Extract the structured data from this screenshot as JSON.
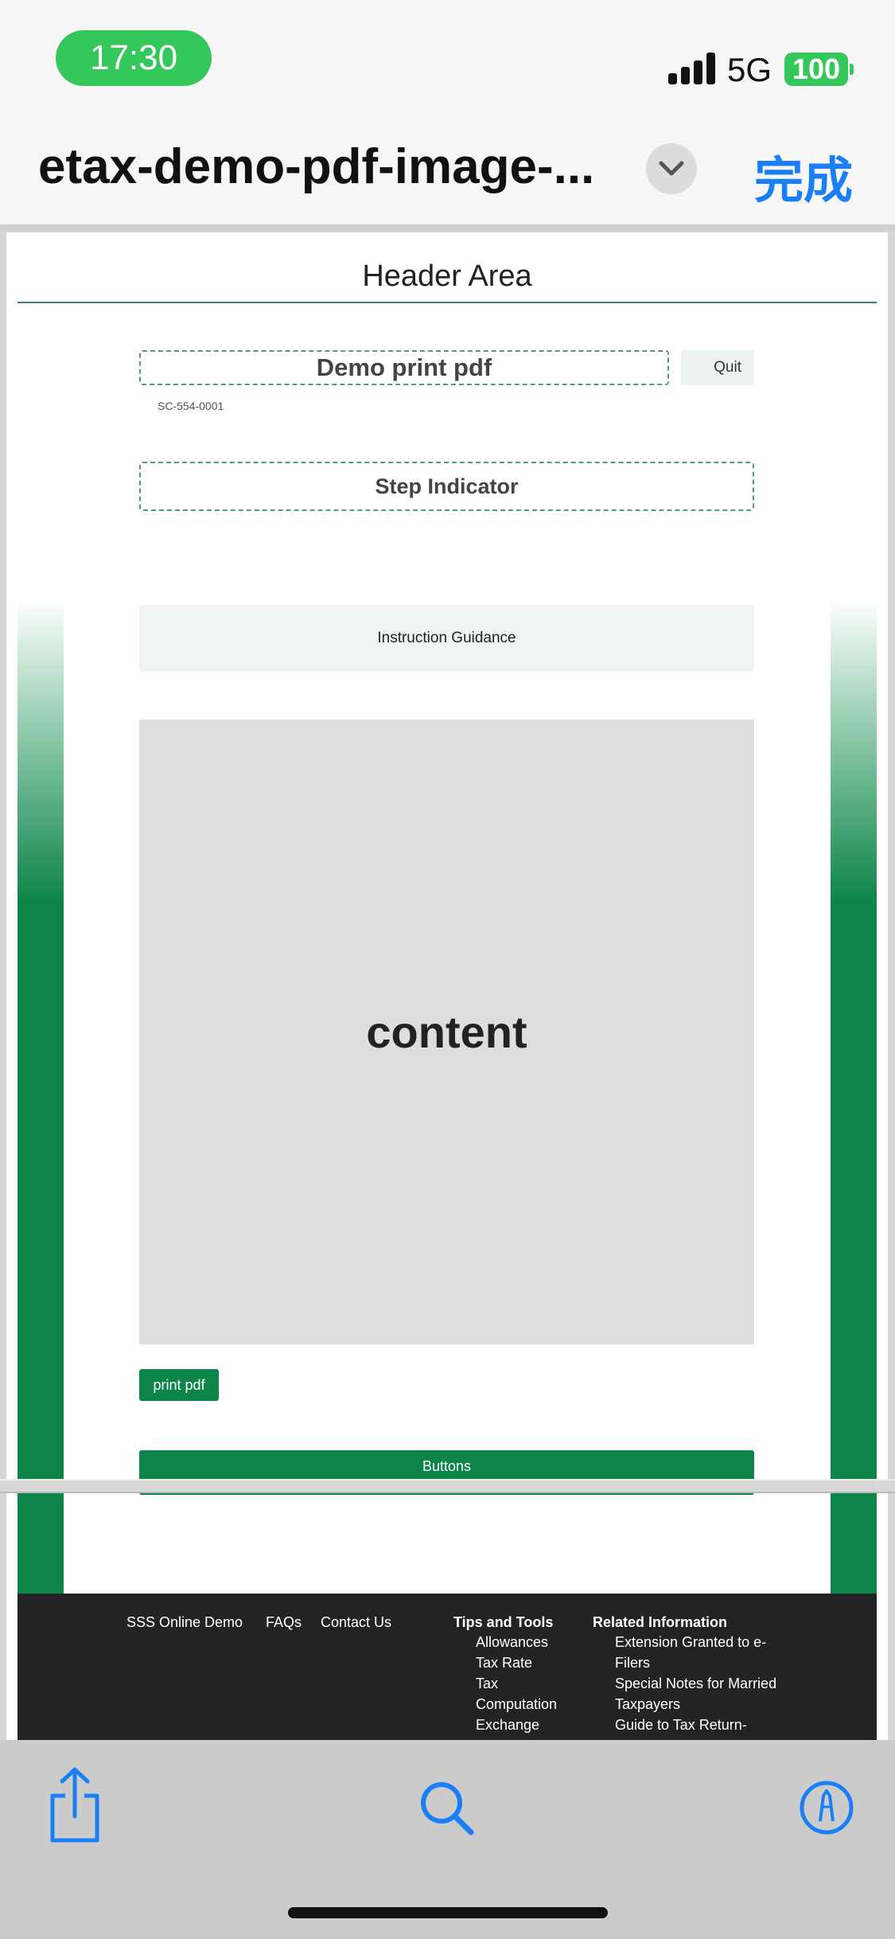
{
  "status_bar": {
    "time": "17:30",
    "network": "5G",
    "battery": "100"
  },
  "nav": {
    "document_title": "etax-demo-pdf-image-...",
    "done_label": "完成"
  },
  "page": {
    "header_area": "Header Area",
    "title": "Demo print pdf",
    "quit_label": "Quit",
    "screen_id": "SC-554-0001",
    "step_indicator": "Step Indicator",
    "instruction_guidance": "Instruction Guidance",
    "content_label": "content",
    "print_button": "print pdf",
    "buttons_bar": "Buttons"
  },
  "footer": {
    "links": [
      "SSS Online Demo",
      "FAQs",
      "Contact Us"
    ],
    "tips_heading": "Tips and Tools",
    "tips_items": [
      "Allowances",
      "Tax Rate",
      "Tax",
      "Computation",
      "Exchange"
    ],
    "related_heading": "Related Information",
    "related_items": [
      "Extension Granted to e-",
      "Filers",
      "Special Notes for Married",
      "Taxpayers",
      "Guide to Tax Return-"
    ]
  },
  "toolbar": {
    "icons": [
      "share-icon",
      "search-icon",
      "markup-icon"
    ]
  },
  "colors": {
    "accent_green": "#0d854a",
    "ios_blue": "#1a7ff6",
    "status_green": "#34c759"
  }
}
